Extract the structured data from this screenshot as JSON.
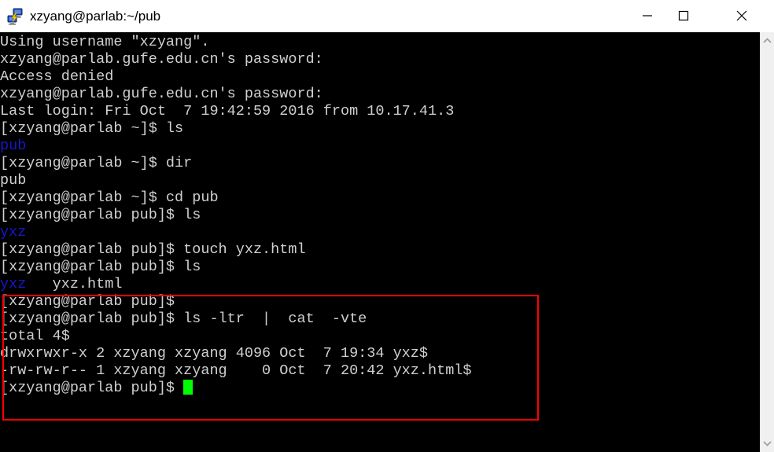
{
  "window": {
    "title": "xzyang@parlab:~/pub",
    "icon": "putty-icon",
    "controls": {
      "minimize": "—",
      "maximize": "□",
      "close": "✕"
    }
  },
  "terminal": {
    "background_color": "#000000",
    "text_color": "#d0d0d0",
    "directory_color": "#1717c9",
    "cursor_color": "#00ff00",
    "lines": [
      {
        "id": "line-01",
        "segments": [
          {
            "text": "Using username \"xzyang\".",
            "color": "white"
          }
        ]
      },
      {
        "id": "line-02",
        "segments": [
          {
            "text": "xzyang@parlab.gufe.edu.cn's password:",
            "color": "white"
          }
        ]
      },
      {
        "id": "line-03",
        "segments": [
          {
            "text": "Access denied",
            "color": "white"
          }
        ]
      },
      {
        "id": "line-04",
        "segments": [
          {
            "text": "xzyang@parlab.gufe.edu.cn's password:",
            "color": "white"
          }
        ]
      },
      {
        "id": "line-05",
        "segments": [
          {
            "text": "Last login: Fri Oct  7 19:42:59 2016 from 10.17.41.3",
            "color": "white"
          }
        ]
      },
      {
        "id": "line-06",
        "segments": [
          {
            "text": "[xzyang@parlab ~]$ ls",
            "color": "white"
          }
        ]
      },
      {
        "id": "line-07",
        "segments": [
          {
            "text": "pub",
            "color": "blue"
          }
        ]
      },
      {
        "id": "line-08",
        "segments": [
          {
            "text": "[xzyang@parlab ~]$ dir",
            "color": "white"
          }
        ]
      },
      {
        "id": "line-09",
        "segments": [
          {
            "text": "pub",
            "color": "white"
          }
        ]
      },
      {
        "id": "line-10",
        "segments": [
          {
            "text": "[xzyang@parlab ~]$ cd pub",
            "color": "white"
          }
        ]
      },
      {
        "id": "line-11",
        "segments": [
          {
            "text": "[xzyang@parlab pub]$ ls",
            "color": "white"
          }
        ]
      },
      {
        "id": "line-12",
        "segments": [
          {
            "text": "yxz",
            "color": "blue"
          }
        ]
      },
      {
        "id": "line-13",
        "segments": [
          {
            "text": "[xzyang@parlab pub]$ touch yxz.html",
            "color": "white"
          }
        ]
      },
      {
        "id": "line-14",
        "segments": [
          {
            "text": "[xzyang@parlab pub]$ ls",
            "color": "white"
          }
        ]
      },
      {
        "id": "line-15",
        "segments": [
          {
            "text": "yxz",
            "color": "blue"
          },
          {
            "text": "   yxz.html",
            "color": "white"
          }
        ]
      },
      {
        "id": "line-16",
        "segments": [
          {
            "text": "[xzyang@parlab pub]$",
            "color": "white"
          }
        ]
      },
      {
        "id": "line-17",
        "segments": [
          {
            "text": "[xzyang@parlab pub]$ ls -ltr  |  cat  -vte",
            "color": "white"
          }
        ]
      },
      {
        "id": "line-18",
        "segments": [
          {
            "text": "total 4$",
            "color": "white"
          }
        ]
      },
      {
        "id": "line-19",
        "segments": [
          {
            "text": "drwxrwxr-x 2 xzyang xzyang 4096 Oct  7 19:34 yxz$",
            "color": "white"
          }
        ]
      },
      {
        "id": "line-20",
        "segments": [
          {
            "text": "-rw-rw-r-- 1 xzyang xzyang    0 Oct  7 20:42 yxz.html$",
            "color": "white"
          }
        ]
      },
      {
        "id": "line-21",
        "segments": [
          {
            "text": "[xzyang@parlab pub]$ ",
            "color": "white"
          }
        ],
        "cursor": true
      }
    ]
  },
  "annotation": {
    "type": "red-rectangle",
    "color": "#ff0000",
    "highlights_lines": [
      "line-16",
      "line-17",
      "line-18",
      "line-19",
      "line-20",
      "line-21"
    ]
  },
  "scrollbar": {
    "up_arrow": "⌃",
    "down_arrow": "⌄"
  }
}
